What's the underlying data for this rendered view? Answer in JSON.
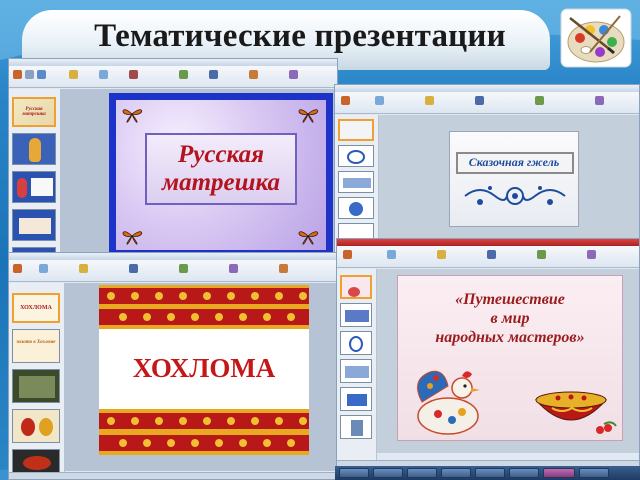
{
  "title": "Тематические презентации",
  "icons": {
    "palette": "paint-palette-icon"
  },
  "windows": {
    "matryoshka": {
      "slide_text_line1": "Русская",
      "slide_text_line2": "матрешка",
      "thumb_label": "Русская матрешка"
    },
    "gzhel": {
      "slide_text": "Сказочная гжель"
    },
    "khokhloma": {
      "slide_text": "ХОХЛОМА",
      "thumb_label_1": "ХОХЛОМА",
      "thumb_label_2": "золото в Хохломе"
    },
    "journey": {
      "slide_text_line1": "«Путешествие",
      "slide_text_line2": "в мир",
      "slide_text_line3": "народных мастеров»"
    }
  },
  "colors": {
    "background": "#1c74b8",
    "matryoshka_frame": "#1d33c8",
    "matryoshka_text": "#b4141e",
    "gzhel_text": "#1e4c9c",
    "khokhloma_text": "#c41818",
    "journey_text": "#9a1c1c"
  }
}
